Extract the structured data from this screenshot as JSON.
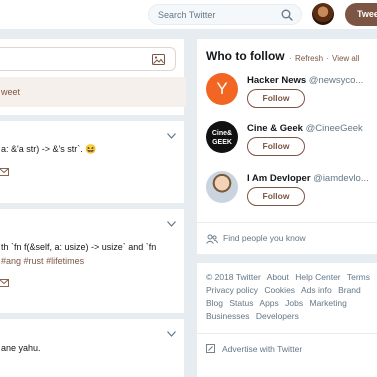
{
  "topbar": {
    "search_placeholder": "Search Twitter",
    "tweet_button": "Twee"
  },
  "composer": {
    "new_tweets_link": "weet"
  },
  "timeline": [
    {
      "lines": [
        "a: &'a str) -> &'s str`. 😆"
      ]
    },
    {
      "lines": [
        "th `fn f(&self, a: usize) -> usize` and `fn"
      ],
      "tags": [
        "#ang",
        "#rust",
        "#lifetimes"
      ]
    },
    {
      "lines": [
        "ane yahu."
      ]
    }
  ],
  "who_to_follow": {
    "title": "Who to follow",
    "sep": "·",
    "refresh": "Refresh",
    "view_all": "View all",
    "accounts": [
      {
        "name": "Hacker News",
        "handle": "@newsyco...",
        "follow": "Follow",
        "avatar_color": "#f26522",
        "avatar_letter": "Y"
      },
      {
        "name": "Cine & Geek",
        "handle": "@CineeGeek",
        "follow": "Follow",
        "avatar_color": "#111111",
        "avatar_letter": "Cine&\nGEEK"
      },
      {
        "name": "I Am Devloper",
        "handle": "@iamdevlo...",
        "follow": "Follow",
        "avatar_color": "#b9c6d2",
        "avatar_letter": ""
      }
    ],
    "find_people": "Find people you know"
  },
  "footer": {
    "links": [
      "© 2018 Twitter",
      "About",
      "Help Center",
      "Terms",
      "Privacy policy",
      "Cookies",
      "Ads info",
      "Brand",
      "Blog",
      "Status",
      "Apps",
      "Jobs",
      "Marketing",
      "Businesses",
      "Developers"
    ],
    "advertise": "Advertise with Twitter"
  },
  "colors": {
    "accent": "#7d5544",
    "muted": "#657786"
  }
}
